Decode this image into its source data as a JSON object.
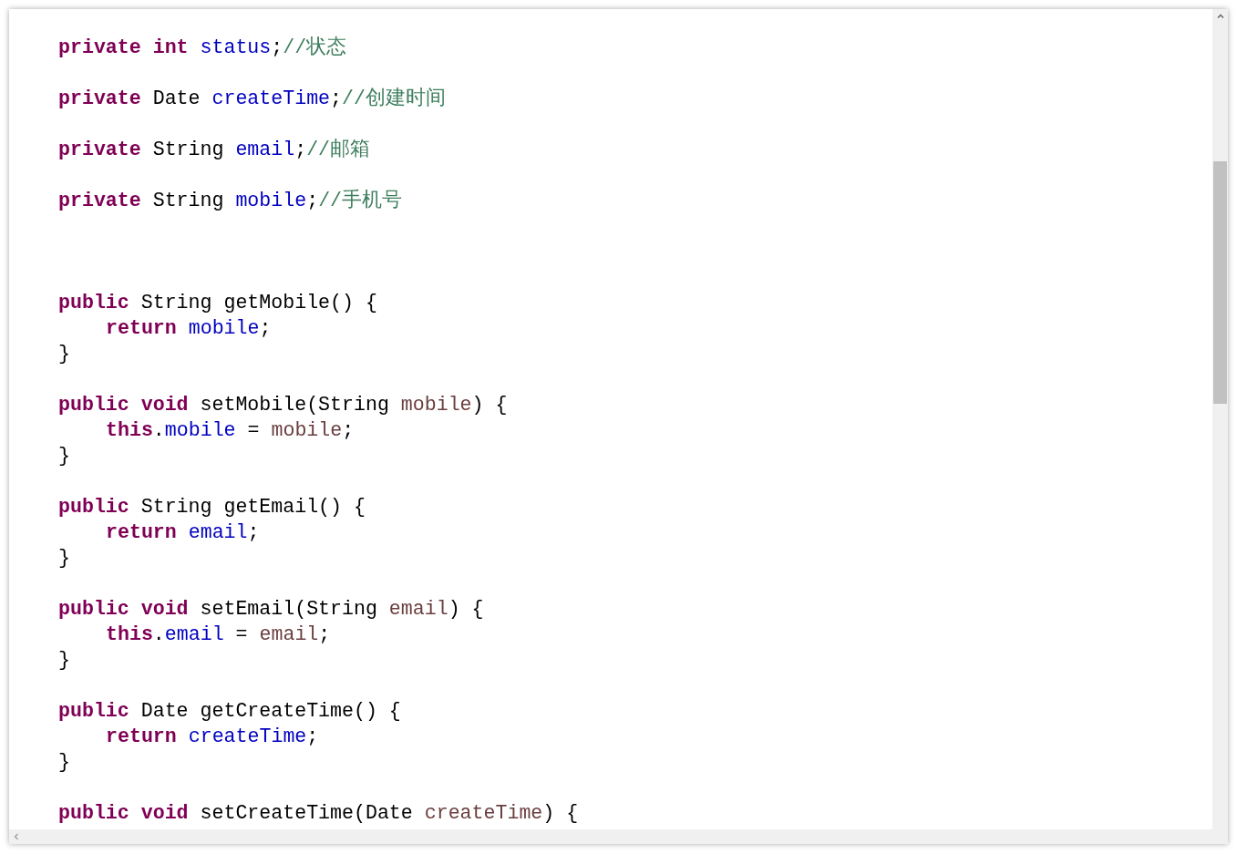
{
  "lines": [
    {
      "kind": "code",
      "tokens": [
        {
          "kind": "keyword",
          "text": "private"
        },
        {
          "kind": "keyword",
          "text": " int"
        },
        {
          "kind": "field",
          "text": " status"
        },
        {
          "kind": "plain",
          "text": ";"
        },
        {
          "kind": "comment",
          "text": "//状态"
        }
      ]
    },
    {
      "kind": "blank"
    },
    {
      "kind": "code",
      "tokens": [
        {
          "kind": "keyword",
          "text": "private"
        },
        {
          "kind": "plain",
          "text": " Date "
        },
        {
          "kind": "field",
          "text": "createTime"
        },
        {
          "kind": "plain",
          "text": ";"
        },
        {
          "kind": "comment",
          "text": "//创建时间"
        }
      ]
    },
    {
      "kind": "blank"
    },
    {
      "kind": "code",
      "tokens": [
        {
          "kind": "keyword",
          "text": "private"
        },
        {
          "kind": "plain",
          "text": " String "
        },
        {
          "kind": "field",
          "text": "email"
        },
        {
          "kind": "plain",
          "text": ";"
        },
        {
          "kind": "comment",
          "text": "//邮箱"
        }
      ]
    },
    {
      "kind": "blank"
    },
    {
      "kind": "code",
      "tokens": [
        {
          "kind": "keyword",
          "text": "private"
        },
        {
          "kind": "plain",
          "text": " String "
        },
        {
          "kind": "field",
          "text": "mobile"
        },
        {
          "kind": "plain",
          "text": ";"
        },
        {
          "kind": "comment",
          "text": "//手机号"
        }
      ]
    },
    {
      "kind": "blank"
    },
    {
      "kind": "blank"
    },
    {
      "kind": "blank"
    },
    {
      "kind": "code",
      "tokens": [
        {
          "kind": "keyword",
          "text": "public"
        },
        {
          "kind": "plain",
          "text": " String getMobile() {"
        }
      ]
    },
    {
      "kind": "indented",
      "tokens": [
        {
          "kind": "keyword",
          "text": "return"
        },
        {
          "kind": "field",
          "text": " mobile"
        },
        {
          "kind": "plain",
          "text": ";"
        }
      ]
    },
    {
      "kind": "code",
      "tokens": [
        {
          "kind": "plain",
          "text": "}"
        }
      ]
    },
    {
      "kind": "blank"
    },
    {
      "kind": "code",
      "tokens": [
        {
          "kind": "keyword",
          "text": "public"
        },
        {
          "kind": "keyword",
          "text": " void"
        },
        {
          "kind": "plain",
          "text": " setMobile(String "
        },
        {
          "kind": "param",
          "text": "mobile"
        },
        {
          "kind": "plain",
          "text": ") {"
        }
      ]
    },
    {
      "kind": "indented",
      "tokens": [
        {
          "kind": "keyword",
          "text": "this"
        },
        {
          "kind": "plain",
          "text": "."
        },
        {
          "kind": "field",
          "text": "mobile"
        },
        {
          "kind": "plain",
          "text": " = "
        },
        {
          "kind": "param",
          "text": "mobile"
        },
        {
          "kind": "plain",
          "text": ";"
        }
      ]
    },
    {
      "kind": "code",
      "tokens": [
        {
          "kind": "plain",
          "text": "}"
        }
      ]
    },
    {
      "kind": "blank"
    },
    {
      "kind": "code",
      "tokens": [
        {
          "kind": "keyword",
          "text": "public"
        },
        {
          "kind": "plain",
          "text": " String getEmail() {"
        }
      ]
    },
    {
      "kind": "indented",
      "tokens": [
        {
          "kind": "keyword",
          "text": "return"
        },
        {
          "kind": "field",
          "text": " email"
        },
        {
          "kind": "plain",
          "text": ";"
        }
      ]
    },
    {
      "kind": "code",
      "tokens": [
        {
          "kind": "plain",
          "text": "}"
        }
      ]
    },
    {
      "kind": "blank"
    },
    {
      "kind": "code",
      "tokens": [
        {
          "kind": "keyword",
          "text": "public"
        },
        {
          "kind": "keyword",
          "text": " void"
        },
        {
          "kind": "plain",
          "text": " setEmail(String "
        },
        {
          "kind": "param",
          "text": "email"
        },
        {
          "kind": "plain",
          "text": ") {"
        }
      ]
    },
    {
      "kind": "indented",
      "tokens": [
        {
          "kind": "keyword",
          "text": "this"
        },
        {
          "kind": "plain",
          "text": "."
        },
        {
          "kind": "field",
          "text": "email"
        },
        {
          "kind": "plain",
          "text": " = "
        },
        {
          "kind": "param",
          "text": "email"
        },
        {
          "kind": "plain",
          "text": ";"
        }
      ]
    },
    {
      "kind": "code",
      "tokens": [
        {
          "kind": "plain",
          "text": "}"
        }
      ]
    },
    {
      "kind": "blank"
    },
    {
      "kind": "code",
      "tokens": [
        {
          "kind": "keyword",
          "text": "public"
        },
        {
          "kind": "plain",
          "text": " Date getCreateTime() {"
        }
      ]
    },
    {
      "kind": "indented",
      "tokens": [
        {
          "kind": "keyword",
          "text": "return"
        },
        {
          "kind": "field",
          "text": " createTime"
        },
        {
          "kind": "plain",
          "text": ";"
        }
      ]
    },
    {
      "kind": "code",
      "tokens": [
        {
          "kind": "plain",
          "text": "}"
        }
      ]
    },
    {
      "kind": "blank"
    },
    {
      "kind": "code",
      "tokens": [
        {
          "kind": "keyword",
          "text": "public"
        },
        {
          "kind": "keyword",
          "text": " void"
        },
        {
          "kind": "plain",
          "text": " setCreateTime(Date "
        },
        {
          "kind": "param",
          "text": "createTime"
        },
        {
          "kind": "plain",
          "text": ") {"
        }
      ]
    }
  ]
}
